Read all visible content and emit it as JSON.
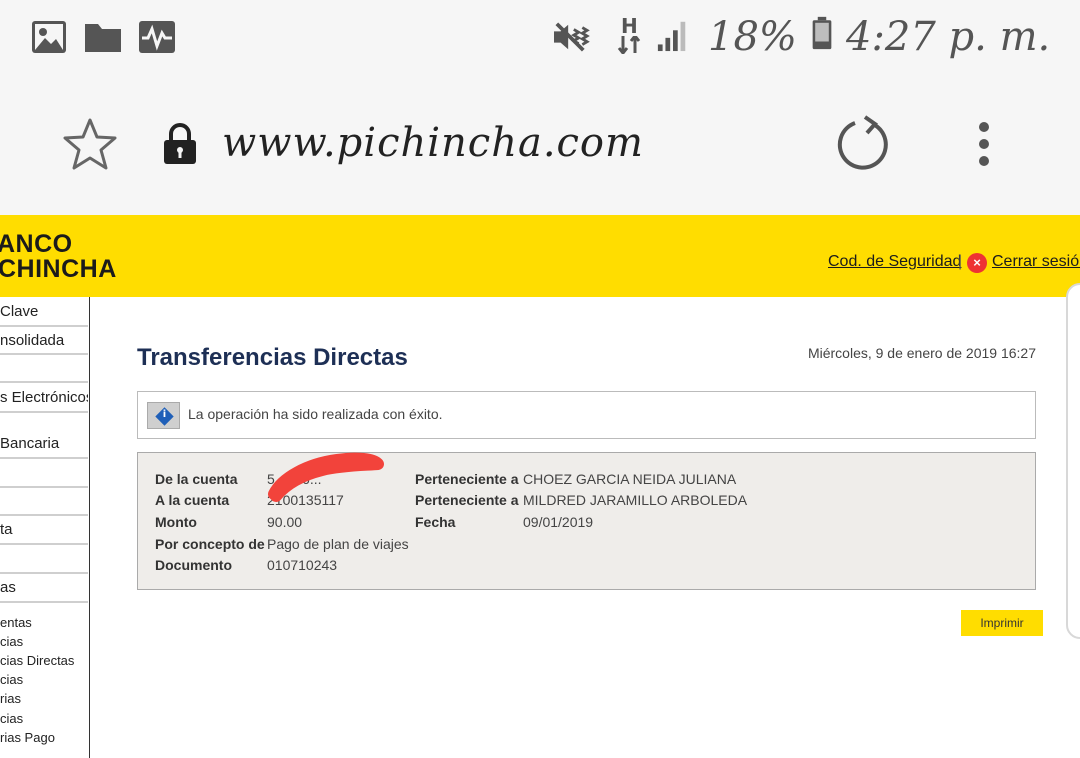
{
  "status_bar": {
    "icons": [
      "image-icon",
      "folder-icon",
      "activity-icon",
      "mute-vibrate-icon",
      "network-h-icon",
      "signal-icon",
      "battery-icon"
    ],
    "network_label": "H",
    "battery_percent": "18%",
    "time": "4:27 p. m."
  },
  "browser": {
    "url": "www.pichincha.com",
    "icons": [
      "star-icon",
      "lock-icon",
      "reload-icon",
      "more-vert-icon"
    ]
  },
  "bank_header": {
    "logo_line1": "ANCO",
    "logo_line2": "CHINCHA",
    "security_code_link": "Cod. de Seguridad",
    "separator": "|",
    "logout_link": "Cerrar sesión",
    "brand_color": "#ffdd00"
  },
  "sidebar": {
    "items": [
      "Clave",
      "nsolidada",
      "s Electrónicos",
      "Bancaria",
      "ta",
      "as"
    ],
    "sub_items": [
      "entas",
      "cias",
      "cias Directas",
      "cias",
      "rias",
      "cias",
      "rias Pago"
    ]
  },
  "main": {
    "title": "Transferencias Directas",
    "date": "Miércoles, 9 de enero de 2019 16:27",
    "message": "La operación ha sido realizada con éxito.",
    "details": {
      "from_account_label": "De la cuenta",
      "from_account_value": "5...126...",
      "to_account_label": "A la cuenta",
      "to_account_value": "2100135117",
      "amount_label": "Monto",
      "amount_value": "90.00",
      "concept_label": "Por concepto de",
      "concept_value": "Pago de plan de viajes",
      "document_label": "Documento",
      "document_value": "010710243",
      "owner1_label": "Perteneciente a",
      "owner1_value": "CHOEZ GARCIA NEIDA JULIANA",
      "owner2_label": "Perteneciente a",
      "owner2_value": "MILDRED JARAMILLO ARBOLEDA",
      "date_label": "Fecha",
      "date_value": "09/01/2019"
    },
    "print_button": "Imprimir"
  }
}
